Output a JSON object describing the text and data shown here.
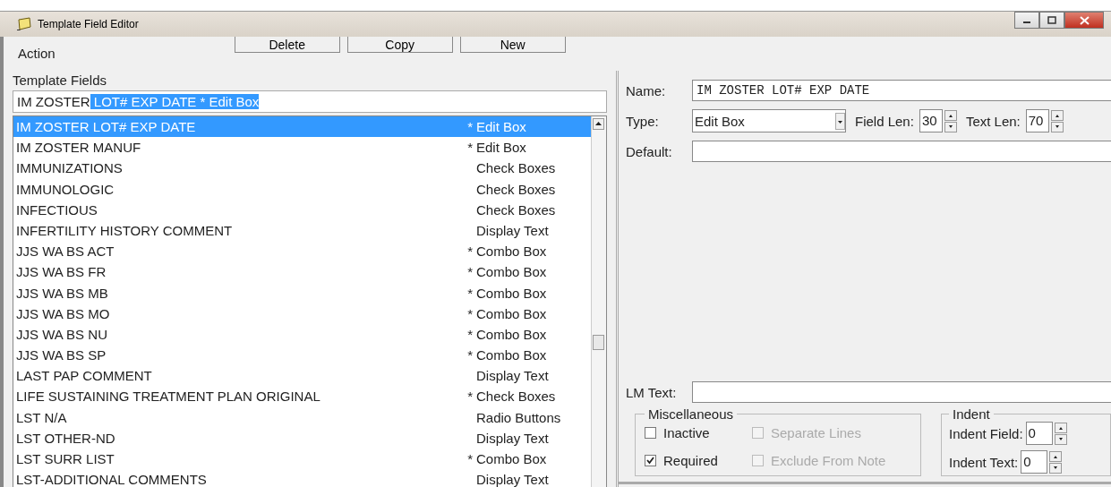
{
  "window": {
    "title": "Template Field Editor"
  },
  "action_bar": {
    "label": "Action",
    "buttons": [
      "Delete",
      "Copy",
      "New"
    ]
  },
  "template_fields": {
    "label": "Template Fields",
    "search": {
      "value": "IM ZOSTER",
      "selection": " LOT# EXP DATE * Edit Box"
    },
    "rows": [
      {
        "name": "IM ZOSTER LOT# EXP DATE",
        "marker": "*",
        "type": "Edit Box",
        "selected": true
      },
      {
        "name": "IM ZOSTER MANUF",
        "marker": "*",
        "type": "Edit Box",
        "selected": false
      },
      {
        "name": "IMMUNIZATIONS",
        "type": "Check Boxes",
        "selected": false
      },
      {
        "name": "IMMUNOLOGIC",
        "type": "Check Boxes",
        "selected": false
      },
      {
        "name": "INFECTIOUS",
        "type": "Check Boxes",
        "selected": false
      },
      {
        "name": "INFERTILITY HISTORY COMMENT",
        "type": "Display Text",
        "selected": false
      },
      {
        "name": "JJS WA BS ACT",
        "marker": "*",
        "type": "Combo Box",
        "selected": false
      },
      {
        "name": "JJS WA BS FR",
        "marker": "*",
        "type": "Combo Box",
        "selected": false
      },
      {
        "name": "JJS WA BS MB",
        "marker": "*",
        "type": "Combo Box",
        "selected": false
      },
      {
        "name": "JJS WA BS MO",
        "marker": "*",
        "type": "Combo Box",
        "selected": false
      },
      {
        "name": "JJS WA BS NU",
        "marker": "*",
        "type": "Combo Box",
        "selected": false
      },
      {
        "name": "JJS WA BS SP",
        "marker": "*",
        "type": "Combo Box",
        "selected": false
      },
      {
        "name": "LAST PAP COMMENT",
        "type": "Display Text",
        "selected": false
      },
      {
        "name": "LIFE SUSTAINING TREATMENT PLAN ORIGINAL",
        "marker": "*",
        "type": "Check Boxes",
        "selected": false
      },
      {
        "name": "LST N/A",
        "type": "Radio Buttons",
        "selected": false
      },
      {
        "name": "LST OTHER-ND",
        "type": "Display Text",
        "selected": false
      },
      {
        "name": "LST SURR LIST",
        "marker": "*",
        "type": "Combo Box",
        "selected": false
      },
      {
        "name": "LST-ADDITIONAL COMMENTS",
        "type": "Display Text",
        "selected": false
      }
    ]
  },
  "details": {
    "name": {
      "label": "Name:",
      "value": "IM ZOSTER LOT# EXP DATE"
    },
    "type": {
      "label": "Type:",
      "value": "Edit Box"
    },
    "field_len": {
      "label": "Field Len:",
      "value": "30"
    },
    "text_len": {
      "label": "Text Len:",
      "value": "70"
    },
    "default": {
      "label": "Default:"
    },
    "lm_text": {
      "label": "LM Text:"
    },
    "miscellaneous": {
      "title": "Miscellaneous",
      "options": [
        {
          "label": "Inactive",
          "checked": false,
          "disabled": false
        },
        {
          "label": "Separate Lines",
          "checked": false,
          "disabled": true
        },
        {
          "label": "Required",
          "checked": true,
          "disabled": false
        },
        {
          "label": "Exclude From Note",
          "checked": false,
          "disabled": true
        }
      ]
    },
    "indent": {
      "title": "Indent",
      "fields": [
        {
          "label": "Indent Field:",
          "value": "0"
        },
        {
          "label": "Indent Text:",
          "value": "0"
        }
      ]
    }
  }
}
